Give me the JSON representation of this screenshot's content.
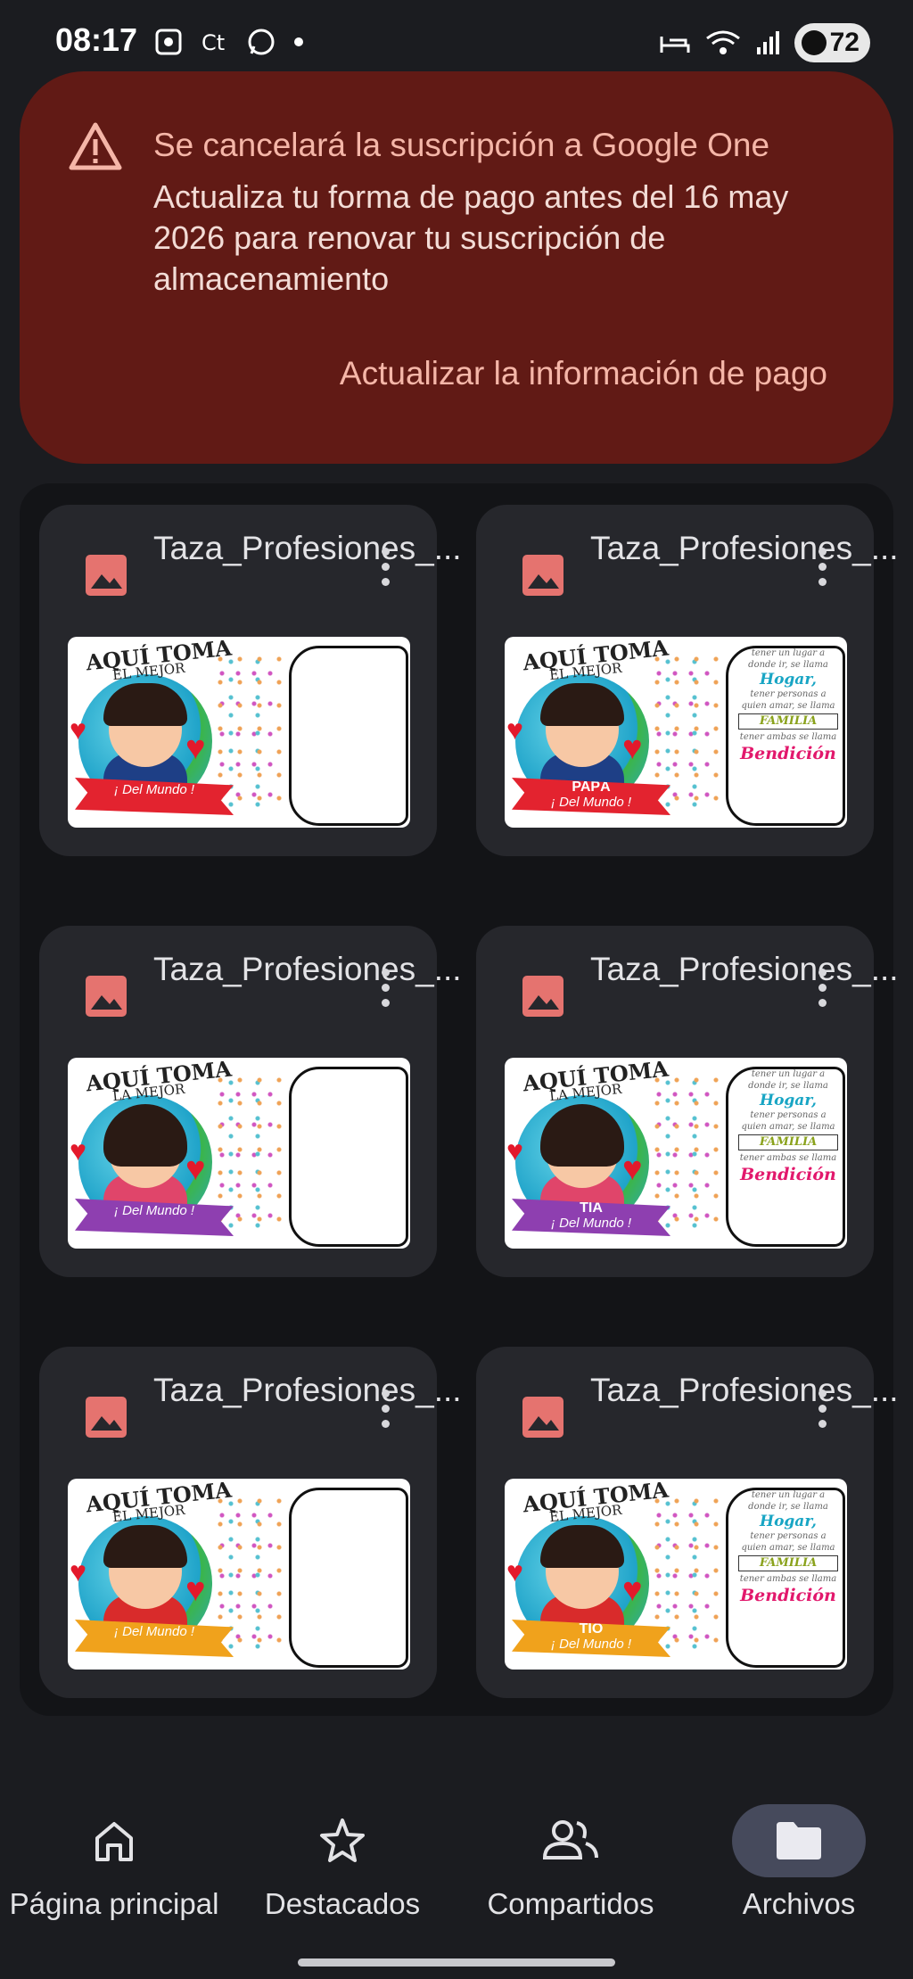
{
  "status_bar": {
    "time": "08:17",
    "battery": "72"
  },
  "alert": {
    "title": "Se cancelará la suscripción a Google One",
    "body": "Actualiza tu forma de pago antes del 16 may 2026 para renovar tu suscripción de almacenamiento",
    "action": "Actualizar la información de pago"
  },
  "files": [
    {
      "name": "Taza_Profesiones_...",
      "thumb_title": "AQUÍ TOMA",
      "thumb_sub": "EL MEJOR",
      "ribbon_name": "",
      "ribbon_text": "¡ Del Mundo !",
      "ribbon_color": "#e3232f",
      "shirt_color": "#1e3f86",
      "hair_girl": false,
      "verse": false
    },
    {
      "name": "Taza_Profesiones_...",
      "thumb_title": "AQUÍ TOMA",
      "thumb_sub": "EL MEJOR",
      "ribbon_name": "PAPÁ",
      "ribbon_text": "¡ Del Mundo !",
      "ribbon_color": "#e3232f",
      "shirt_color": "#1e3f86",
      "hair_girl": false,
      "verse": true
    },
    {
      "name": "Taza_Profesiones_...",
      "thumb_title": "AQUÍ TOMA",
      "thumb_sub": "LA MEJOR",
      "ribbon_name": "",
      "ribbon_text": "¡ Del Mundo !",
      "ribbon_color": "#8e3fb0",
      "shirt_color": "#e0456a",
      "hair_girl": true,
      "verse": false
    },
    {
      "name": "Taza_Profesiones_...",
      "thumb_title": "AQUÍ TOMA",
      "thumb_sub": "LA MEJOR",
      "ribbon_name": "TÍA",
      "ribbon_text": "¡ Del Mundo !",
      "ribbon_color": "#8e3fb0",
      "shirt_color": "#e0456a",
      "hair_girl": true,
      "verse": true
    },
    {
      "name": "Taza_Profesiones_...",
      "thumb_title": "AQUÍ TOMA",
      "thumb_sub": "EL MEJOR",
      "ribbon_name": "",
      "ribbon_text": "¡ Del Mundo !",
      "ribbon_color": "#f0a21c",
      "shirt_color": "#d92b2b",
      "hair_girl": false,
      "verse": false
    },
    {
      "name": "Taza_Profesiones_...",
      "thumb_title": "AQUÍ TOMA",
      "thumb_sub": "EL MEJOR",
      "ribbon_name": "TIO",
      "ribbon_text": "¡ Del Mundo !",
      "ribbon_color": "#f0a21c",
      "shirt_color": "#d92b2b",
      "hair_girl": false,
      "verse": true
    }
  ],
  "verse_text": {
    "line1": "tener un lugar a donde ir, se llama",
    "hogar": "Hogar,",
    "line2": "tener personas a quien amar, se llama",
    "familia": "FAMILIA",
    "line3": "tener ambas se llama",
    "bendicion": "Bendición"
  },
  "nav": [
    {
      "label": "Página principal",
      "icon": "home-icon",
      "active": false
    },
    {
      "label": "Destacados",
      "icon": "star-icon",
      "active": false
    },
    {
      "label": "Compartidos",
      "icon": "people-icon",
      "active": false
    },
    {
      "label": "Archivos",
      "icon": "folder-icon",
      "active": true
    }
  ],
  "colors": {
    "alert_bg": "#611a15",
    "alert_accent": "#f5b6a8",
    "image_icon": "#e5736f",
    "card_bg": "#26272c",
    "nav_active_pill": "#464a5c"
  }
}
